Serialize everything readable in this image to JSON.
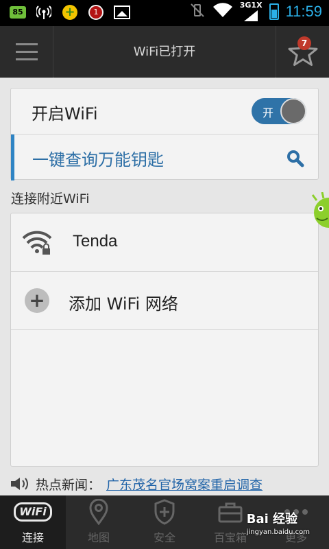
{
  "status_bar": {
    "battery_app_badge": "85",
    "notification_count": "1",
    "network_type": "3G1X",
    "time": "11:59"
  },
  "app_bar": {
    "title": "WiFi已打开",
    "favorites_badge": "7"
  },
  "wifi_switch": {
    "label": "开启WiFi",
    "toggle_text": "开",
    "state": "on"
  },
  "key_search": {
    "label": "一键查询万能钥匙"
  },
  "nearby": {
    "section_title": "连接附近WiFi",
    "networks": [
      {
        "name": "Tenda",
        "secured": true
      }
    ],
    "add_label": "添加 WiFi 网络"
  },
  "news": {
    "label": "热点新闻：",
    "headline": "广东茂名官场窝案重启调查"
  },
  "tabs": [
    {
      "label": "连接",
      "icon": "wifi-icon",
      "active": true
    },
    {
      "label": "地图",
      "icon": "map-pin-icon",
      "active": false
    },
    {
      "label": "安全",
      "icon": "shield-icon",
      "active": false
    },
    {
      "label": "百宝箱",
      "icon": "toolbox-icon",
      "active": false
    },
    {
      "label": "更多",
      "icon": "more-icon",
      "active": false
    }
  ],
  "watermark": {
    "brand": "Bai 经验",
    "url": "jingyan.baidu.com"
  },
  "colors": {
    "accent_blue": "#2f84c4",
    "time_blue": "#2bb0e8",
    "toggle_on": "#2f73a8",
    "badge_red": "#c0392b"
  }
}
